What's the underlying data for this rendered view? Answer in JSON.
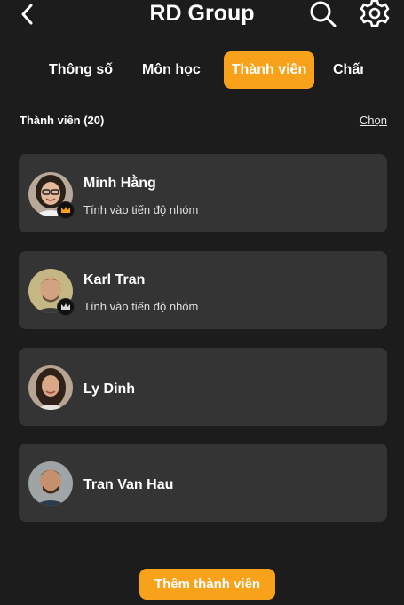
{
  "header": {
    "title": "RD Group",
    "back_icon": "chevron-left-icon",
    "search_icon": "search-icon",
    "settings_icon": "gear-icon"
  },
  "tabs": [
    {
      "label": "Thông số",
      "active": false
    },
    {
      "label": "Môn học",
      "active": false
    },
    {
      "label": "Thành viên",
      "active": true
    },
    {
      "label": "Chấm",
      "active": false
    }
  ],
  "members_section": {
    "label": "Thành viên (20)",
    "select_label": "Chọn"
  },
  "members": [
    {
      "name": "Minh Hằng",
      "subtitle": "Tính vào tiến độ nhóm",
      "crown": true
    },
    {
      "name": "Karl Tran",
      "subtitle": "Tính vào tiến độ nhóm",
      "crown": true
    },
    {
      "name": "Ly Dinh",
      "subtitle": "",
      "crown": false
    },
    {
      "name": "Tran Van Hau",
      "subtitle": "",
      "crown": false
    }
  ],
  "add_button": {
    "label": "Thêm thành viên"
  },
  "colors": {
    "background": "#1c1c1c",
    "card": "#343434",
    "accent": "#f7a21a"
  }
}
